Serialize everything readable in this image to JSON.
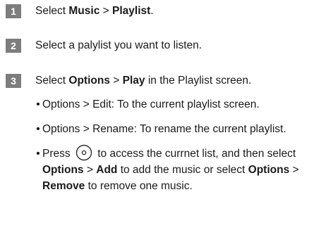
{
  "steps": [
    {
      "number": "1",
      "parts": [
        "Select ",
        "Music",
        " > ",
        "Playlist",
        "."
      ]
    },
    {
      "number": "2",
      "text": "Select a palylist you want to listen."
    },
    {
      "number": "3",
      "parts": [
        "Select ",
        "Options",
        " > ",
        "Play",
        " in the Playlist screen."
      ]
    }
  ],
  "bullets": {
    "edit": "Options > Edit: To the current playlist screen.",
    "rename": "Options > Rename: To rename the current playlist.",
    "press": {
      "a": "Press",
      "b": "to access the currnet list, and then select",
      "c": "Options",
      "d": ">",
      "e": "Add",
      "f": "to add the music or select",
      "g": "Options",
      "h": ">",
      "i": "Remove",
      "j": "to remove one music."
    }
  },
  "icons": {
    "ok_button": "ok-button-icon"
  }
}
